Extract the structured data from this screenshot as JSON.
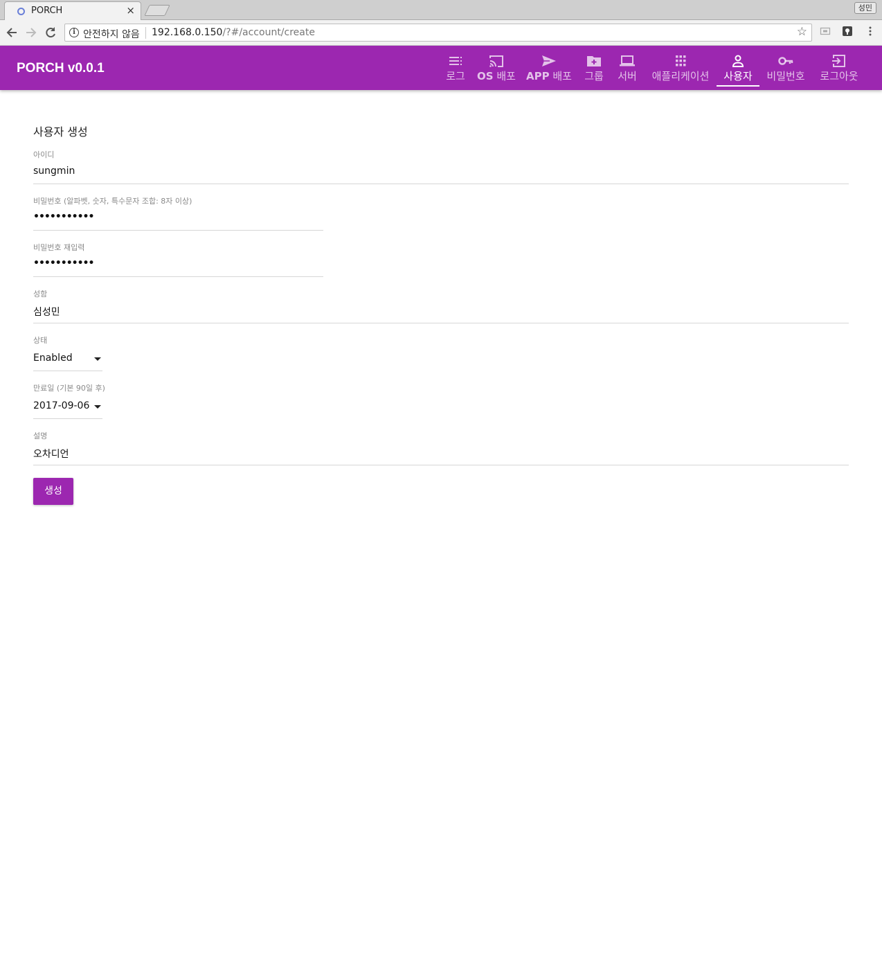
{
  "browser": {
    "tab_title": "PORCH",
    "tab_close": "×",
    "profile_name": "성민",
    "security_label": "안전하지 않음",
    "url_host": "192.168.0.150",
    "url_path": "/?#/account/create"
  },
  "app": {
    "brand": "PORCH v0.0.1",
    "accent_color": "#9c27b0",
    "nav": [
      {
        "key": "log",
        "label": "로그",
        "icon": "list-icon"
      },
      {
        "key": "os",
        "label_bold": "OS",
        "label": " 배포",
        "icon": "cast-icon"
      },
      {
        "key": "app",
        "label_bold": "APP",
        "label": " 배포",
        "icon": "send-icon"
      },
      {
        "key": "group",
        "label": "그룹",
        "icon": "folder-add-icon"
      },
      {
        "key": "server",
        "label": "서버",
        "icon": "laptop-icon"
      },
      {
        "key": "application",
        "label": "애플리케이션",
        "icon": "apps-grid-icon"
      },
      {
        "key": "user",
        "label": "사용자",
        "icon": "person-icon",
        "active": true
      },
      {
        "key": "password",
        "label": "비밀번호",
        "icon": "key-icon"
      },
      {
        "key": "logout",
        "label": "로그아웃",
        "icon": "logout-icon"
      }
    ]
  },
  "form": {
    "title": "사용자 생성",
    "username": {
      "label": "아이디",
      "value": "sungmin"
    },
    "password": {
      "label": "비밀번호 (알파벳, 숫자, 특수문자 조합: 8자 이상)",
      "value": "•••••••••••"
    },
    "password_confirm": {
      "label": "비밀번호 재입력",
      "value": "•••••••••••"
    },
    "name": {
      "label": "성함",
      "value": "심성민"
    },
    "status": {
      "label": "상태",
      "value": "Enabled"
    },
    "expiry": {
      "label": "만료일 (기본 90일 후)",
      "value": "2017-09-06"
    },
    "description": {
      "label": "설명",
      "value": "오차디언"
    },
    "submit_label": "생성"
  }
}
